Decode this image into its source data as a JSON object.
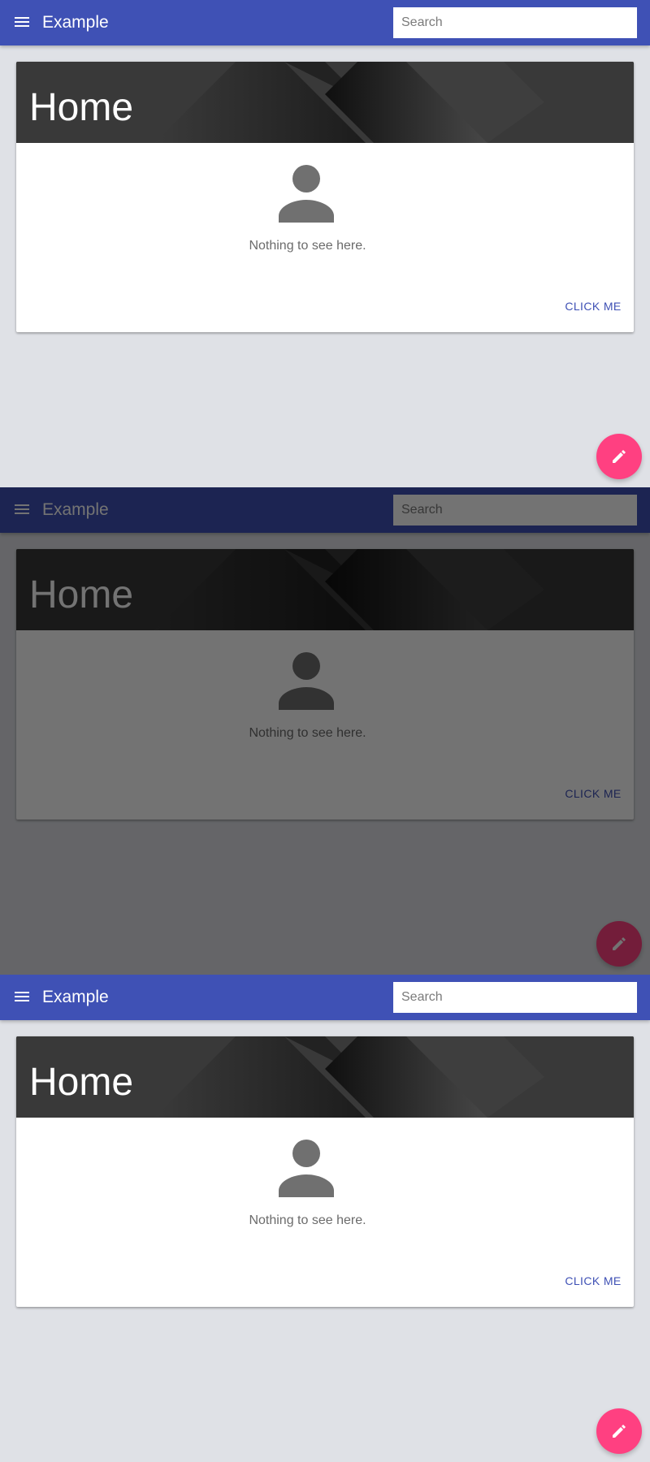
{
  "app": {
    "title": "Example"
  },
  "search": {
    "placeholder": "Search"
  },
  "card": {
    "title": "Home",
    "empty_message": "Nothing to see here.",
    "action_label": "CLICK ME"
  },
  "icons": {
    "menu": "menu-icon",
    "avatar": "person-icon",
    "fab": "pencil-icon"
  },
  "colors": {
    "primary": "#3f51b5",
    "accent": "#ff4081",
    "background": "#dfe1e6"
  },
  "frames": [
    {
      "state": "default"
    },
    {
      "state": "dimmed"
    },
    {
      "state": "default"
    }
  ]
}
